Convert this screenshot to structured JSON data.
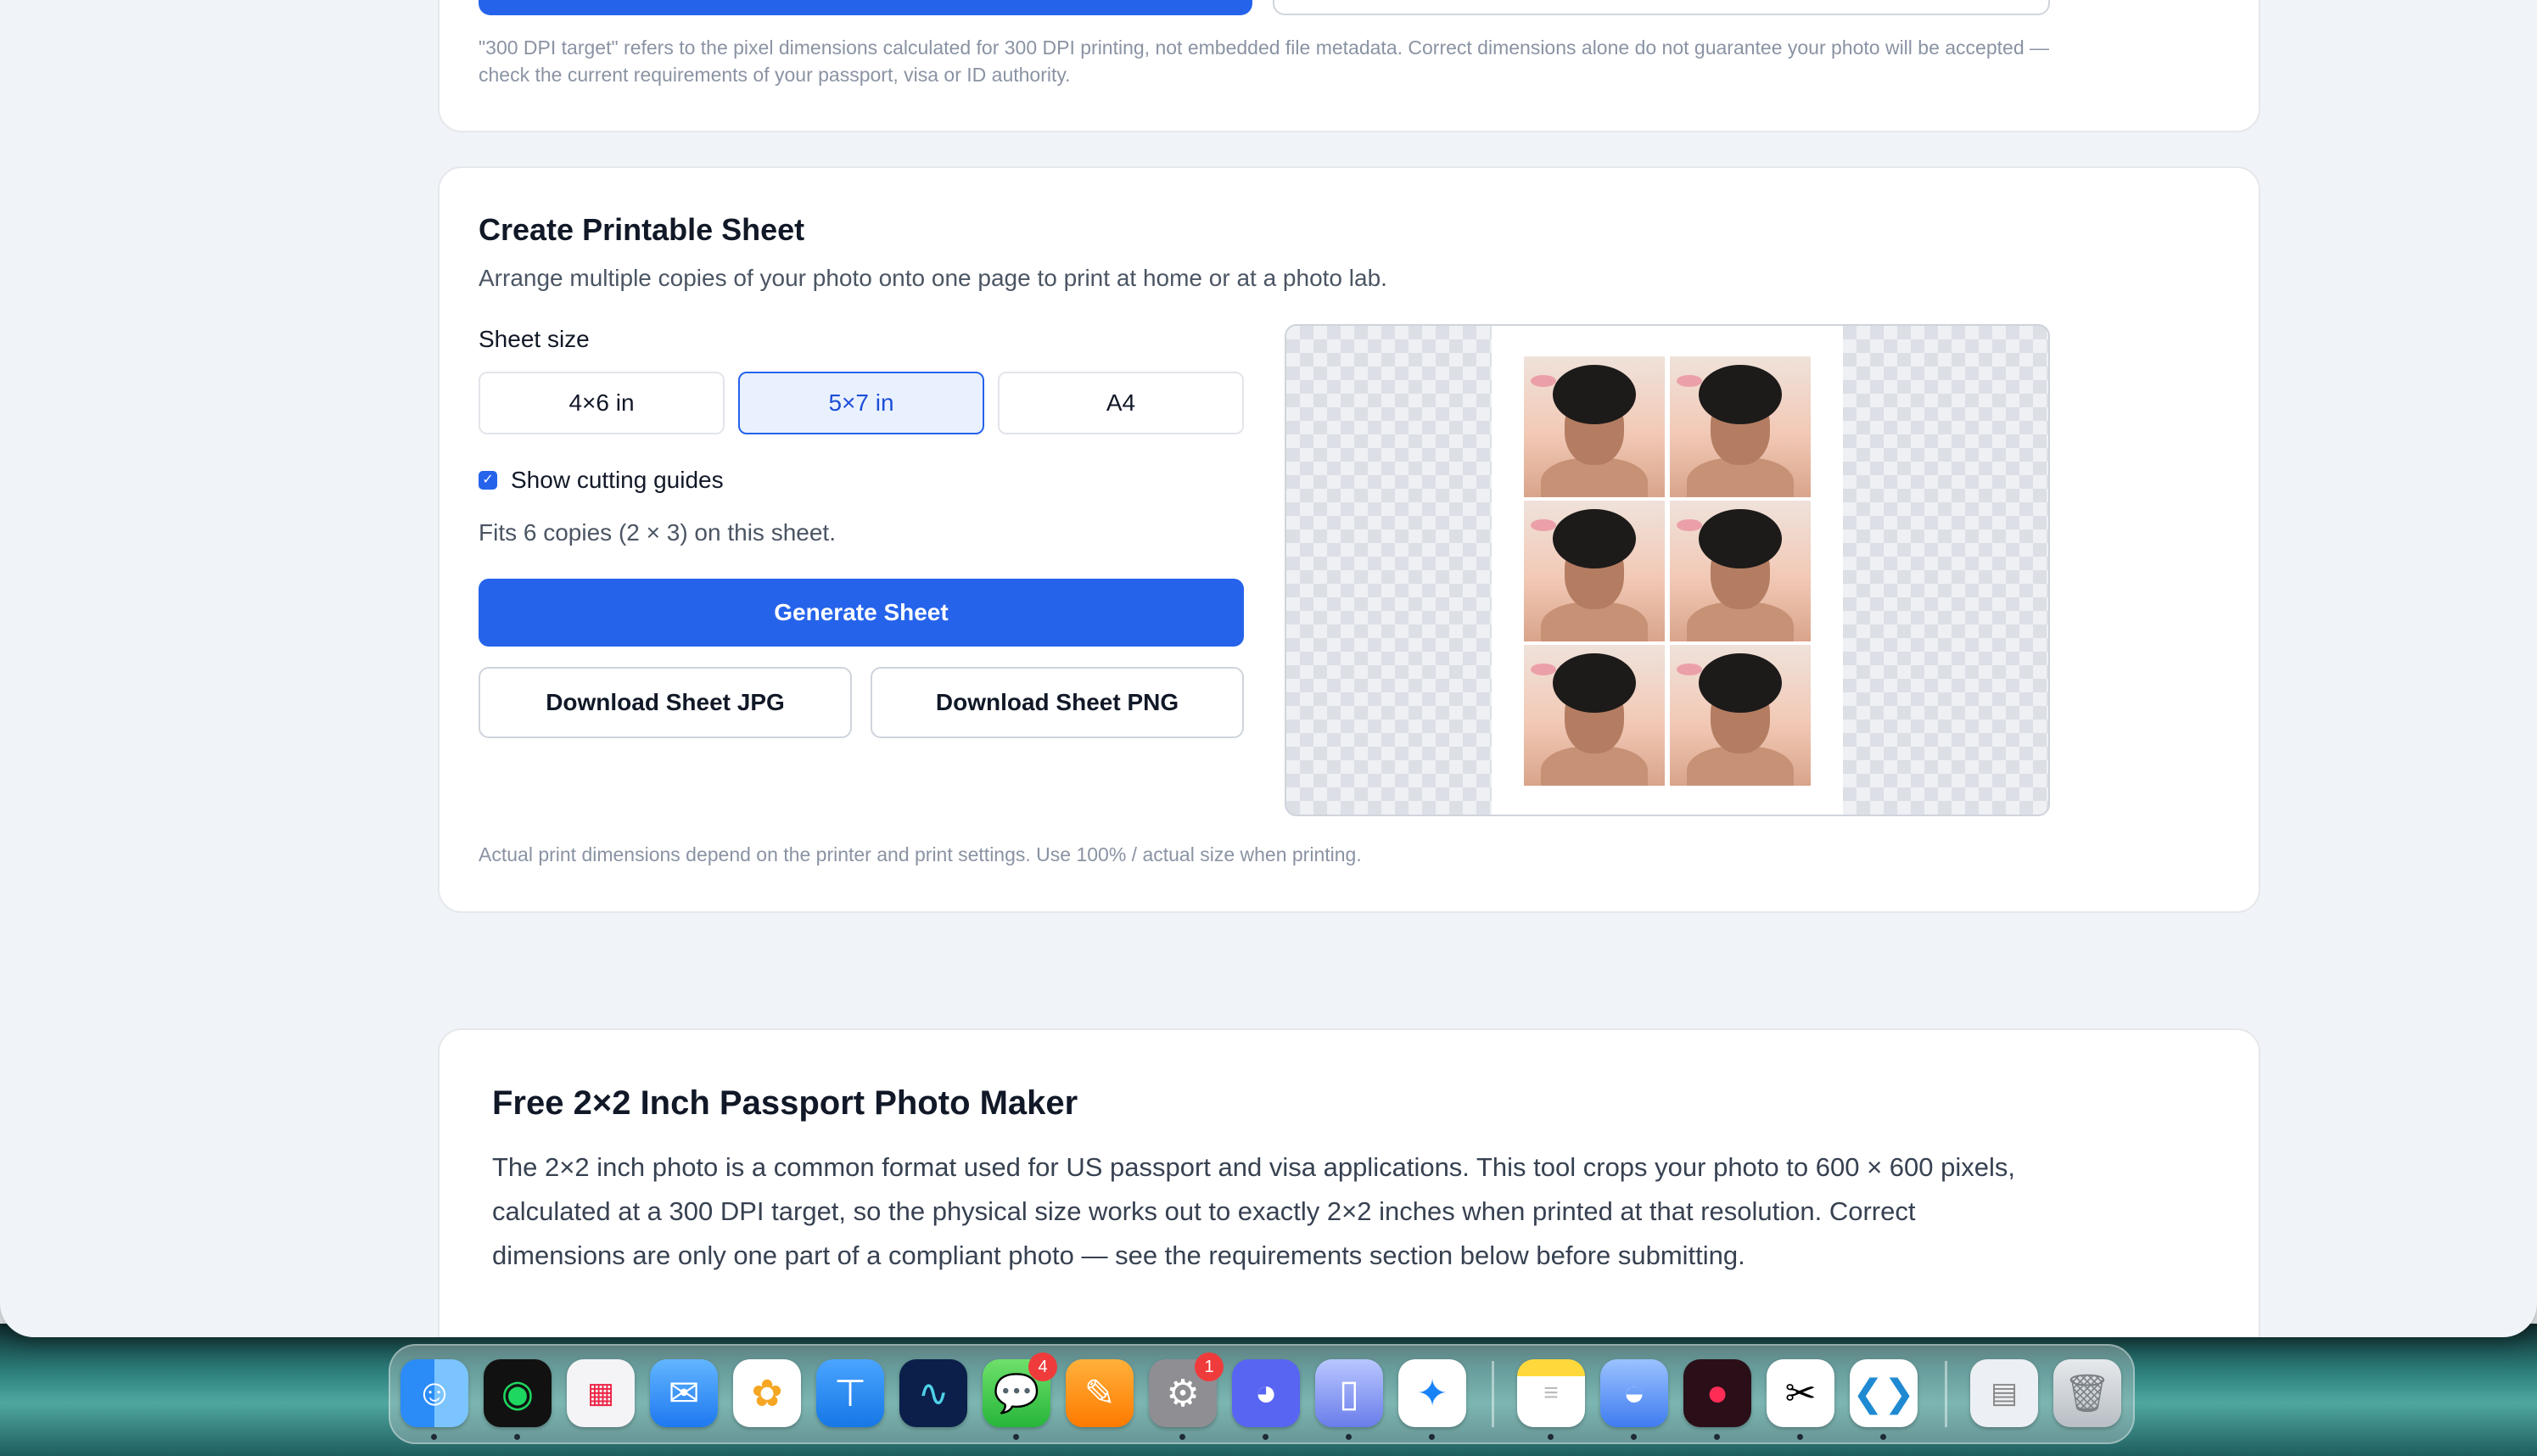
{
  "top_card": {
    "note": "\"300 DPI target\" refers to the pixel dimensions calculated for 300 DPI printing, not embedded file metadata. Correct dimensions alone do not guarantee your photo will be accepted — check the current requirements of your passport, visa or ID authority."
  },
  "sheet_card": {
    "title": "Create Printable Sheet",
    "subtitle": "Arrange multiple copies of your photo onto one page to print at home or at a photo lab.",
    "sheet_size_label": "Sheet size",
    "sizes": [
      "4×6 in",
      "5×7 in",
      "A4"
    ],
    "selected_size": "5×7 in",
    "cutting_guides_label": "Show cutting guides",
    "cutting_guides_checked": true,
    "fits_text": "Fits 6 copies (2 × 3) on this sheet.",
    "generate_label": "Generate Sheet",
    "download_jpg_label": "Download Sheet JPG",
    "download_png_label": "Download Sheet PNG",
    "footnote": "Actual print dimensions depend on the printer and print settings. Use 100% / actual size when printing."
  },
  "info_card": {
    "title": "Free 2×2 Inch Passport Photo Maker",
    "paragraph": "The 2×2 inch photo is a common format used for US passport and visa applications. This tool crops your photo to 600 × 600 pixels, calculated at a 300 DPI target, so the physical size works out to exactly 2×2 inches when printed at that resolution. Correct dimensions are only one part of a compliant photo — see the requirements section below before submitting."
  },
  "dock": {
    "badges": {
      "messages": "4",
      "settings": "1"
    }
  },
  "colors": {
    "accent": "#2563eb",
    "page_bg": "#f0f3f7"
  }
}
